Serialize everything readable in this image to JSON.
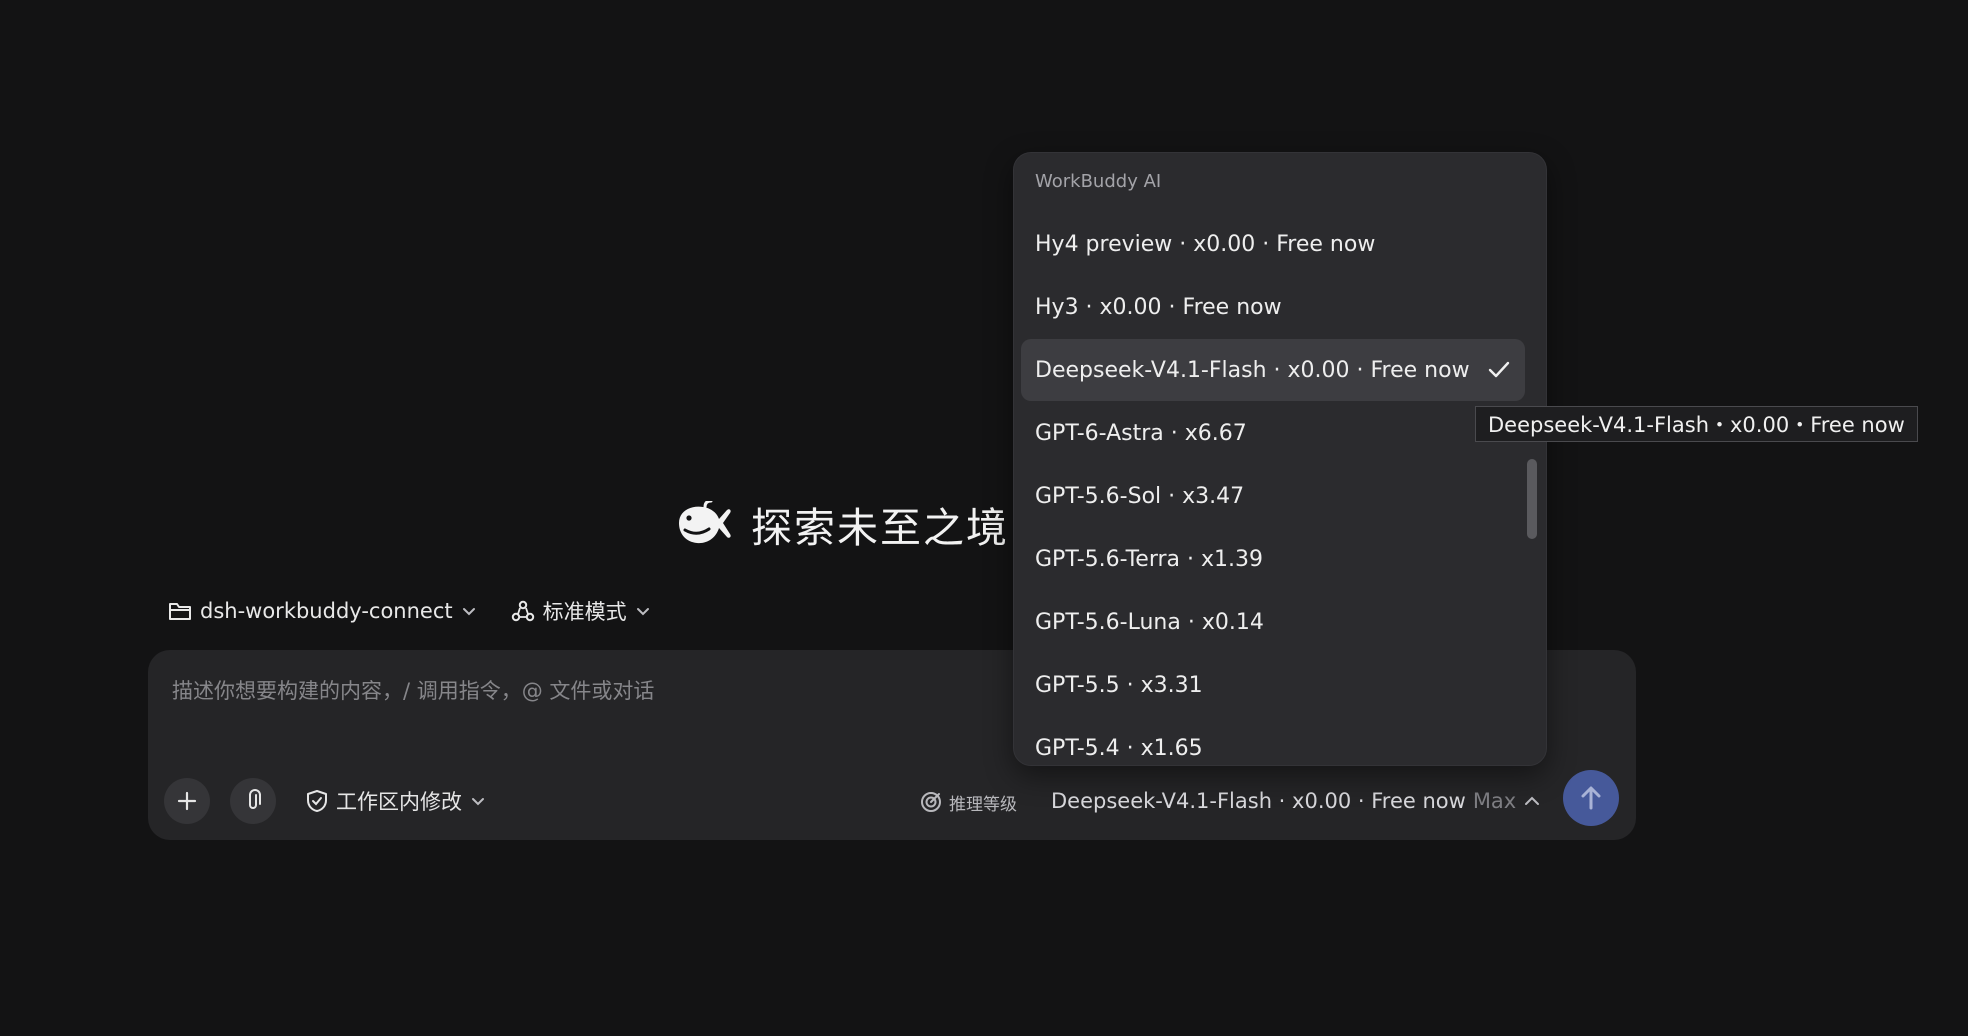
{
  "hero": {
    "title": "探索未至之境",
    "logo_icon": "whale-logo-icon"
  },
  "context": {
    "project_name": "dsh-workbuddy-connect",
    "project_icon": "folder-icon",
    "mode_label": "标准模式",
    "mode_icon": "agents-icon"
  },
  "composer": {
    "placeholder": "描述你想要构建的内容，/ 调用指令，@ 文件或对话",
    "value": "",
    "add_icon": "plus-icon",
    "attach_icon": "paperclip-icon",
    "permission_label": "工作区内修改",
    "permission_icon": "shield-check-icon",
    "reasoning_label": "推理等级",
    "reasoning_icon": "target-icon",
    "selected_model": "Deepseek-V4.1-Flash · x0.00 · Free now",
    "effort_level": "Max",
    "send_icon": "arrow-up-icon"
  },
  "dropdown": {
    "header": "WorkBuddy AI",
    "items": [
      {
        "label": "Hy4 preview · x0.00 · Free now",
        "selected": false
      },
      {
        "label": "Hy3 · x0.00 · Free now",
        "selected": false
      },
      {
        "label": "Deepseek-V4.1-Flash · x0.00 · Free now",
        "selected": true
      },
      {
        "label": "GPT-6-Astra · x6.67",
        "selected": false
      },
      {
        "label": "GPT-5.6-Sol · x3.47",
        "selected": false
      },
      {
        "label": "GPT-5.6-Terra · x1.39",
        "selected": false
      },
      {
        "label": "GPT-5.6-Luna · x0.14",
        "selected": false
      },
      {
        "label": "GPT-5.5 · x3.31",
        "selected": false
      },
      {
        "label": "GPT-5.4 · x1.65",
        "selected": false
      }
    ]
  },
  "tooltip": {
    "text": "Deepseek-V4.1-Flash・x0.00・Free now"
  },
  "colors": {
    "background": "#131314",
    "panel": "#252527",
    "dropdown": "#2b2b2e",
    "selected_row": "#3d3d41",
    "send_button": "#46599a",
    "muted_text": "#86868a"
  }
}
